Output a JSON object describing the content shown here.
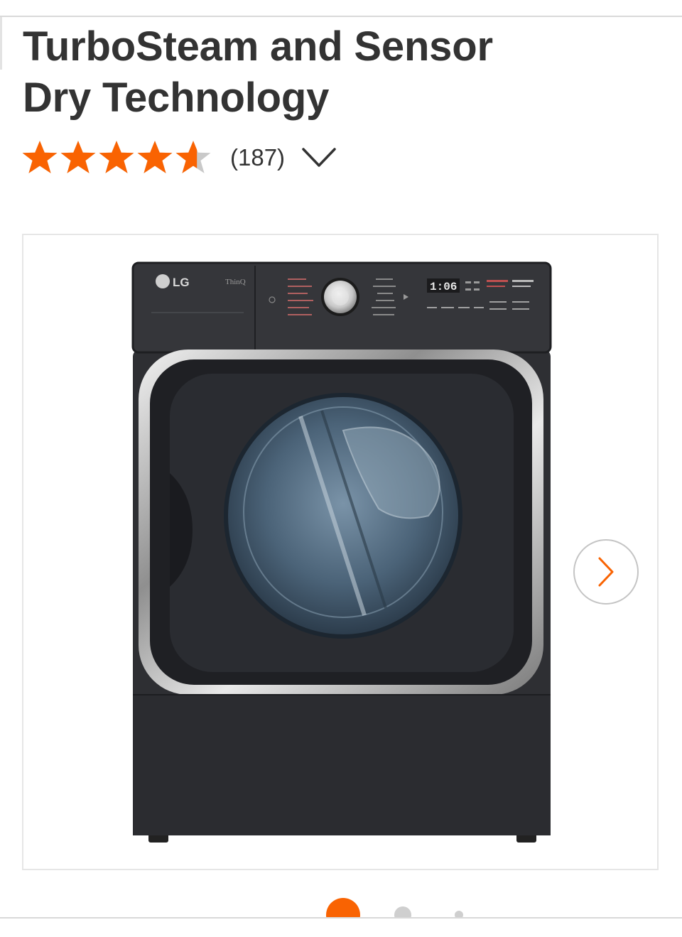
{
  "product": {
    "title_line_1": "TurboSteam and Sensor",
    "title_line_2": "Dry Technology"
  },
  "rating": {
    "value": 4.6,
    "max": 5,
    "review_count": "(187)"
  },
  "colors": {
    "brand_orange": "#f96302",
    "star_empty": "#c9c9c9",
    "text": "#333333"
  },
  "icons": {
    "expand": "chevron-down-icon",
    "next": "chevron-right-icon"
  },
  "gallery": {
    "image_count": 3,
    "active_index": 1,
    "brand_logo": "LG",
    "panel_label": "ThinQ",
    "display_time": "1:06"
  }
}
